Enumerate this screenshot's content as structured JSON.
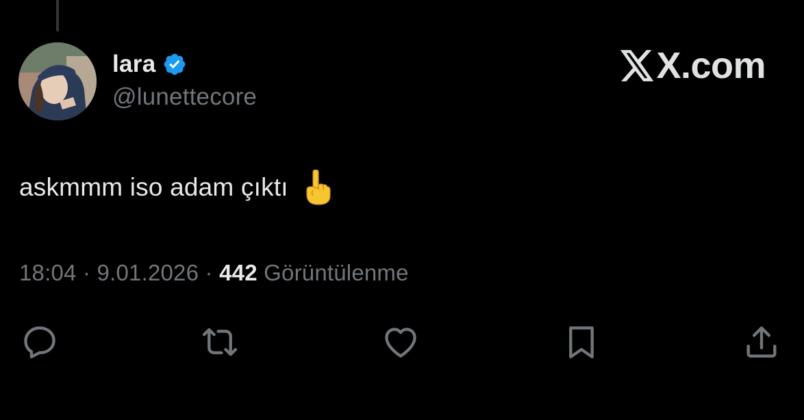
{
  "tweet": {
    "author": {
      "display_name": "lara",
      "handle": "@lunettecore",
      "verified": true
    },
    "brand": "X.com",
    "text": "askmmm iso adam çıktı",
    "emoji": "☝",
    "time": "18:04",
    "date": "9.01.2026",
    "separator": "·",
    "views_count": "442",
    "views_label": "Görüntülenme"
  },
  "actions": {
    "icons": [
      "reply-icon",
      "retweet-icon",
      "like-icon",
      "bookmark-icon",
      "share-icon"
    ]
  },
  "colors": {
    "background": "#000000",
    "primary_text": "#e7e9ea",
    "secondary_text": "#71767b",
    "verified_badge": "#1d9bf0",
    "thread_line": "#333639"
  }
}
